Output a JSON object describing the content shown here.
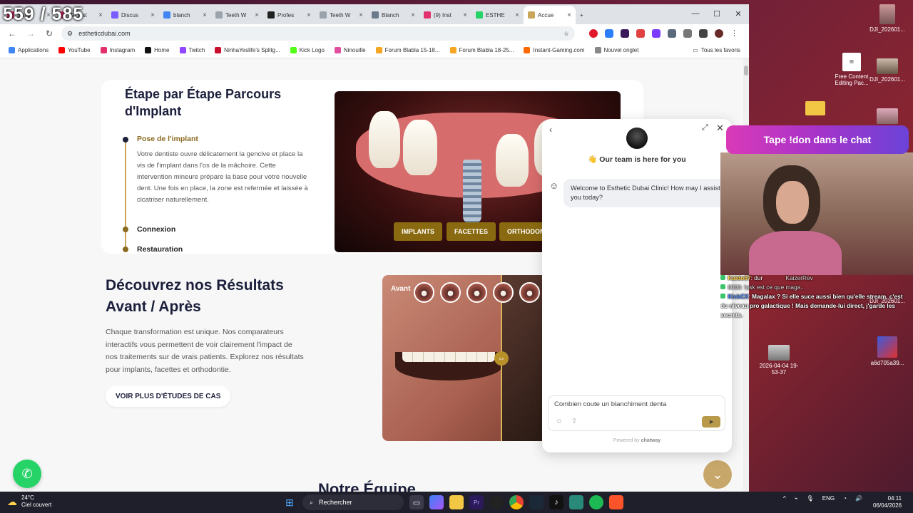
{
  "overlay": {
    "counter": "559 / 585",
    "banner": "Tape !don dans le chat",
    "chat": [
      {
        "user": "Kaido67",
        "text": "dur",
        "extra": "KaizerRev"
      },
      {
        "user": "",
        "text": "8000: !ask est ce que maga..."
      },
      {
        "user": "KickCX",
        "text": "Magalax ? Si elle suce aussi bien qu'elle stream, c'est du niveau pro galactique ! Mais demande-lui direct, j'garde les secrets."
      }
    ]
  },
  "desktop": {
    "icons": [
      {
        "label": "DJI_202601..."
      },
      {
        "label": "Free Content Editing Pac..."
      },
      {
        "label": "DJI_202601..."
      },
      {
        "label": "DJI_202601..."
      },
      {
        "label": "2026-04-04 19-53-37"
      },
      {
        "label": "a6d705a39..."
      }
    ]
  },
  "browser": {
    "tabs": [
      {
        "label": "Insta",
        "color": "#e1306c"
      },
      {
        "label": "(9) Inst",
        "color": "#e1306c"
      },
      {
        "label": "Discus",
        "color": "#7b5cff"
      },
      {
        "label": "blanch",
        "color": "#4285f4"
      },
      {
        "label": "Teeth W",
        "color": "#9aa3ab"
      },
      {
        "label": "Profes",
        "color": "#222222"
      },
      {
        "label": "Teeth W",
        "color": "#9aa3ab"
      },
      {
        "label": "Blanch",
        "color": "#6a7a8a"
      },
      {
        "label": "(9) Inst",
        "color": "#e1306c"
      },
      {
        "label": "ESTHE",
        "color": "#25d366"
      },
      {
        "label": "Accue",
        "color": "#c9a65a"
      }
    ],
    "url": "estheticdubai.com",
    "bookmarks": [
      {
        "label": "Applications",
        "color": "#4285f4"
      },
      {
        "label": "YouTube",
        "color": "#ff0000"
      },
      {
        "label": "Instagram",
        "color": "#e1306c"
      },
      {
        "label": "Home",
        "color": "#111111"
      },
      {
        "label": "Twitch",
        "color": "#9146ff"
      },
      {
        "label": "NinhaYeslife's Splitg...",
        "color": "#c8102e"
      },
      {
        "label": "Kick Logo",
        "color": "#53fc18"
      },
      {
        "label": "Ninouille",
        "color": "#e04fa0"
      },
      {
        "label": "Forum Blabla 15-18...",
        "color": "#f5a623"
      },
      {
        "label": "Forum Blabla 18-25...",
        "color": "#f5a623"
      },
      {
        "label": "Instant-Gaming.com",
        "color": "#ff6a00"
      },
      {
        "label": "Nouvel onglet",
        "color": "#888888"
      }
    ],
    "all_bookmarks": "Tous les favoris"
  },
  "page": {
    "steps_title": "Étape par Étape Parcours d'Implant",
    "step1": "Pose de l'implant",
    "step1_desc": "Votre dentiste ouvre délicatement la gencive et place la vis de l'implant dans l'os de la mâchoire. Cette intervention mineure prépare la base pour votre nouvelle dent. Une fois en place, la zone est refermée et laissée à cicatriser naturellement.",
    "step2": "Connexion",
    "step3": "Restauration",
    "categories": [
      "IMPLANTS",
      "FACETTES",
      "ORTHODON"
    ],
    "results_title": "Découvrez nos Résultats Avant / Après",
    "results_desc": "Chaque transformation est unique. Nos comparateurs interactifs vous permettent de voir clairement l'impact de nos traitements sur de vrais patients. Explorez nos résultats pour implants, facettes et orthodontie.",
    "more_button": "VOIR PLUS D'ÉTUDES DE CAS",
    "avant_label": "Avant",
    "team_title": "Notre Équipe"
  },
  "chat_widget": {
    "team_line": "👋 Our team is here for you",
    "welcome": "Welcome to Esthetic Dubai Clinic! How may I assist you today?",
    "input_value": "Combien coute un blanchiment denta",
    "powered_prefix": "Powered by",
    "powered_brand": "chatway"
  },
  "taskbar": {
    "temp": "24°C",
    "weather": "Ciel couvert",
    "search_placeholder": "Rechercher",
    "lang": "ENG",
    "time": "04:11",
    "date": "06/04/2026"
  }
}
